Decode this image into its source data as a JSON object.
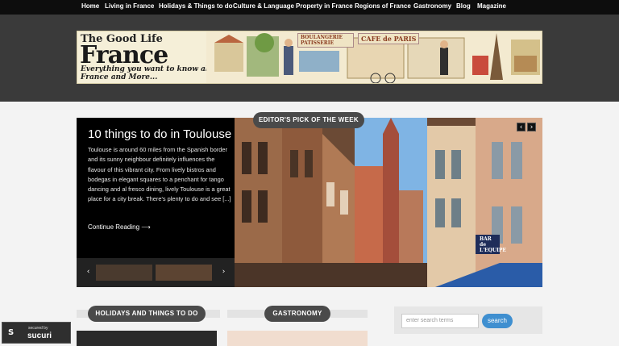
{
  "nav": {
    "items": [
      "Home",
      "Living in France",
      "Holidays & Things to do",
      "Culture & Language",
      "Property in France",
      "Regions of France",
      "Gastronomy",
      "Blog",
      "Magazine"
    ]
  },
  "banner": {
    "logo_line1": "The Good Life",
    "logo_line2": "France",
    "tagline": "Everything you want to know about France and More...",
    "signs": [
      "BOULANGERIE PATISSERIE",
      "CAFE de PARIS"
    ]
  },
  "featured": {
    "pill": "EDITOR'S PICK OF THE WEEK",
    "title": "10 things to do in Toulouse",
    "body": "Toulouse is around 60 miles from the  Spanish border and its sunny neighbour definitely influences the flavour of this vibrant city. From lively bistros and bodegas in elegant squares to a penchant for tango dancing and al fresco dining, lively Toulouse is a great place for a city break. There's plenty to do and see [...]",
    "more": "Continue Reading ⟶",
    "shop_sign": "BAR de L'EQUIPE"
  },
  "sections": {
    "holidays": "HOLIDAYS AND THINGS TO DO",
    "gastronomy": "GASTRONOMY"
  },
  "search": {
    "placeholder": "enter search terms",
    "button": "search"
  },
  "badge": {
    "line1": "secured by",
    "line2": "sucuri"
  },
  "colors": {
    "nav_bg": "#0d0d0d",
    "header_bg": "#3a3a3a",
    "pill_bg": "#4a4a4a",
    "accent": "#3f8fd0"
  },
  "icons": [
    "chevron-left-icon",
    "chevron-right-icon",
    "sucuri-logo-icon"
  ]
}
